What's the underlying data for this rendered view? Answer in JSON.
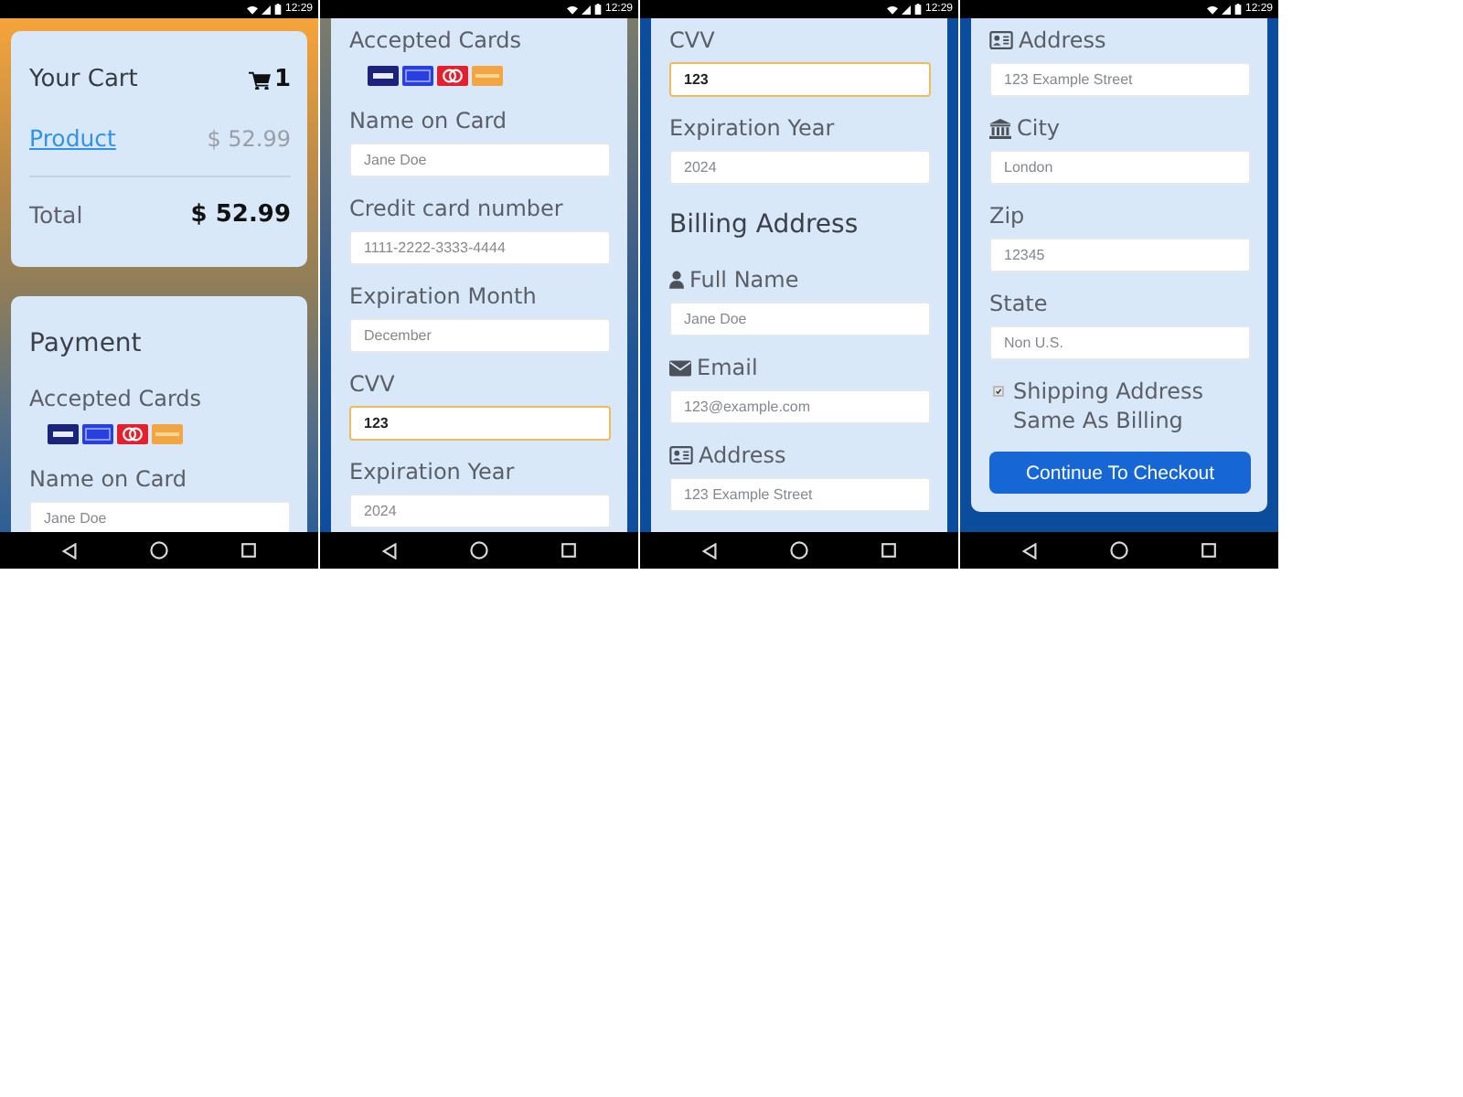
{
  "screens": [
    {
      "status_time": "12:29",
      "cards": [
        {
          "kind": "cart",
          "continues_above": false,
          "continues_below": false,
          "title": "Your Cart",
          "count": "1",
          "items": [
            {
              "name": "Product",
              "price": "$ 52.99"
            }
          ],
          "total_label": "Total",
          "total": "$ 52.99"
        },
        {
          "kind": "form",
          "continues_above": false,
          "continues_below": true,
          "rows": [
            {
              "kind": "heading",
              "text": "Payment"
            },
            {
              "kind": "cards",
              "label": "Accepted Cards"
            },
            {
              "kind": "text",
              "label": "Name on Card",
              "placeholder": "Jane Doe",
              "focused": false
            }
          ]
        }
      ]
    },
    {
      "status_time": "12:29",
      "cards": [
        {
          "kind": "form",
          "continues_above": true,
          "continues_below": true,
          "rows": [
            {
              "kind": "cards",
              "label": "Accepted Cards"
            },
            {
              "kind": "text",
              "label": "Name on Card",
              "placeholder": "Jane Doe",
              "focused": false
            },
            {
              "kind": "text",
              "label": "Credit card number",
              "placeholder": "1111-2222-3333-4444",
              "focused": false
            },
            {
              "kind": "text",
              "label": "Expiration Month",
              "placeholder": "December",
              "focused": false
            },
            {
              "kind": "text",
              "label": "CVV",
              "value": "123",
              "focused": true
            },
            {
              "kind": "text",
              "label": "Expiration Year",
              "placeholder": "2024",
              "focused": false
            }
          ]
        }
      ]
    },
    {
      "status_time": "12:29",
      "cards": [
        {
          "kind": "form",
          "continues_above": true,
          "continues_below": true,
          "rows": [
            {
              "kind": "text",
              "label": "CVV",
              "value": "123",
              "focused": true
            },
            {
              "kind": "text",
              "label": "Expiration Year",
              "placeholder": "2024",
              "focused": false
            },
            {
              "kind": "heading",
              "text": "Billing Address"
            },
            {
              "kind": "person",
              "label": "Full Name",
              "placeholder": "Jane Doe",
              "focused": false
            },
            {
              "kind": "email",
              "label": "Email",
              "placeholder": "123@example.com",
              "focused": false
            },
            {
              "kind": "address",
              "label": "Address",
              "placeholder": "123 Example Street",
              "focused": false
            }
          ]
        }
      ]
    },
    {
      "status_time": "12:29",
      "cards": [
        {
          "kind": "form",
          "continues_above": true,
          "continues_below": false,
          "rows": [
            {
              "kind": "address",
              "label": "Address",
              "placeholder": "123 Example Street",
              "focused": false
            },
            {
              "kind": "city",
              "label": "City",
              "placeholder": "London",
              "focused": false
            },
            {
              "kind": "text",
              "label": "Zip",
              "placeholder": "12345",
              "focused": false
            },
            {
              "kind": "text",
              "label": "State",
              "placeholder": "Non U.S.",
              "focused": false
            },
            {
              "kind": "checkbox",
              "label": "Shipping Address Same As Billing",
              "checked": true
            },
            {
              "kind": "button",
              "label": "Continue To Checkout"
            }
          ]
        }
      ]
    }
  ]
}
